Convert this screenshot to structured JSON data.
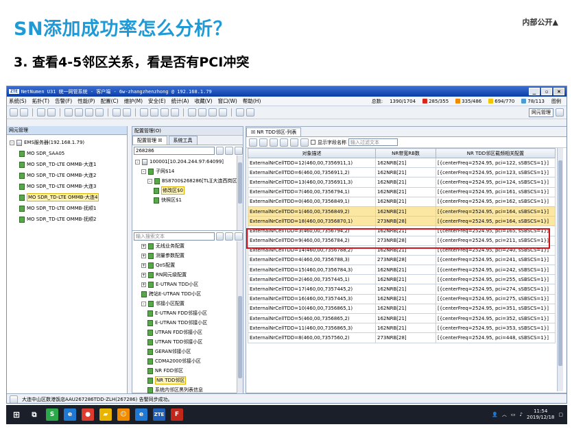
{
  "slide": {
    "title": "SN添加成功率怎么分析？",
    "badge": "内部公开▲",
    "subtitle": "3. 查看4-5邻区关系，看是否有PCI冲突"
  },
  "window": {
    "logo": "ZTE",
    "title": "NetNumen U31 统一网管系统 - 客户端 - 6w-zhangzhenzhong @ 192.168.1.79"
  },
  "menu": [
    "系统(S)",
    "拓扑(T)",
    "告警(F)",
    "性能(P)",
    "配置(C)",
    "维护(M)",
    "安全(E)",
    "统计(A)",
    "收藏(V)",
    "窗口(W)",
    "帮助(H)"
  ],
  "stats": {
    "summary_label": "总数:",
    "summary_value": "1390/1704",
    "items": [
      {
        "value": "285/355",
        "color": "#d9261c"
      },
      {
        "value": "335/486",
        "color": "#f08a00"
      },
      {
        "value": "694/770",
        "color": "#f2c500"
      },
      {
        "value": "78/113",
        "color": "#4a9ad6"
      }
    ],
    "legend_label": "图例"
  },
  "toolbar": {
    "right_combo": "网元管理"
  },
  "left_panel": {
    "title": "网元管理",
    "tree": [
      {
        "label": "EMS服务器(192.168.1.79)",
        "level": 0,
        "expander": "-"
      },
      {
        "label": "MO SDR_SAA05",
        "level": 1
      },
      {
        "label": "MO SDR_TD-LTE OMMB-大连1",
        "level": 1
      },
      {
        "label": "MO SDR_TD-LTE OMMB-大连2",
        "level": 1
      },
      {
        "label": "MO SDR_TD-LTE OMMB-大连3",
        "level": 1
      },
      {
        "label": "MO SDR_TD-LTE OMMB-大连4",
        "level": 1,
        "selected": true
      },
      {
        "label": "MO SDR_TD-LTE OMMB-抚顺1",
        "level": 1
      },
      {
        "label": "MO SDR_TD-LTE OMMB-抚顺2",
        "level": 1
      }
    ]
  },
  "mid_panel": {
    "header": "配置管理(O)",
    "tabs": [
      "配置管理 ☒",
      "系统工具"
    ],
    "search_value": "268286",
    "tree_top": [
      {
        "label": "100001[10.204.244.97:64099]",
        "level": 0,
        "expander": "-"
      },
      {
        "label": "子网$14",
        "level": 1,
        "expander": "-"
      },
      {
        "label": "BS8700$268286[TL][大连西岗区",
        "level": 2,
        "expander": "-"
      },
      {
        "label": "修改区$0",
        "level": 3,
        "selected": true
      },
      {
        "label": "快照区$1",
        "level": 3
      }
    ],
    "search2_placeholder": "输入搜索文本",
    "tree_bottom": [
      {
        "label": "无线业务配置",
        "level": 1,
        "expander": "+"
      },
      {
        "label": "测量参数配置",
        "level": 1,
        "expander": "+"
      },
      {
        "label": "QoS配置",
        "level": 1,
        "expander": "+"
      },
      {
        "label": "RN网元级配置",
        "level": 1,
        "expander": "+"
      },
      {
        "label": "E-UTRAN TDD小区",
        "level": 1,
        "expander": "+"
      },
      {
        "label": "跨站E-UTRAN TDD小区",
        "level": 1
      },
      {
        "label": "邻接小区配置",
        "level": 1,
        "expander": "-"
      },
      {
        "label": "E-UTRAN FDD邻接小区",
        "level": 2
      },
      {
        "label": "E-UTRAN TDD邻接小区",
        "level": 2
      },
      {
        "label": "UTRAN FDD邻接小区",
        "level": 2
      },
      {
        "label": "UTRAN TDD邻接小区",
        "level": 2
      },
      {
        "label": "GERAN邻接小区",
        "level": 2
      },
      {
        "label": "CDMA2000邻接小区",
        "level": 2
      },
      {
        "label": "NR FDD邻区",
        "level": 2
      },
      {
        "label": "NR TDD邻区",
        "level": 2,
        "selected": true
      },
      {
        "label": "系统内邻区黑列表信息",
        "level": 2
      }
    ]
  },
  "right_panel": {
    "tab": "NR TDD邻区-列表",
    "checkbox_label": "显示字段名称",
    "filter_placeholder": "输入过滤文本",
    "columns": [
      "对象描述",
      "NR带宽RB数",
      "NR TDD邻区载频相关配置"
    ],
    "rows": [
      [
        "ExternalNrCellTDD=12(460,00,7356911,1)",
        "162NRB[21]",
        "[{centerFreq=2524.95, pci=122, sSBSCS=1}]"
      ],
      [
        "ExternalNrCellTDD=6(460,00,7356911,2)",
        "162NRB[21]",
        "[{centerFreq=2524.95, pci=123, sSBSCS=1}]"
      ],
      [
        "ExternalNrCellTDD=13(460,00,7356911,3)",
        "162NRB[21]",
        "[{centerFreq=2524.95, pci=124, sSBSCS=1}]"
      ],
      [
        "ExternalNrCellTDD=7(460,00,7356794,1)",
        "162NRB[21]",
        "[{centerFreq=2524.95, pci=161, sSBSCS=1}]"
      ],
      [
        "ExternalNrCellTDD=0(460,00,7356849,1)",
        "162NRB[21]",
        "[{centerFreq=2524.95, pci=162, sSBSCS=1}]"
      ],
      [
        "ExternalNrCellTDD=1(460,00,7356849,2)",
        "162NRB[21]",
        "[{centerFreq=2524.95, pci=164, sSBSCS=1}]"
      ],
      [
        "ExternalNrCellTDD=18(460,00,7356870,1)",
        "273NRB[28]",
        "[{centerFreq=2524.95, pci=164, sSBSCS=1}]"
      ],
      [
        "ExternalNrCellTDD=3(460,00,7356794,2)",
        "162NRB[21]",
        "[{centerFreq=2524.95, pci=165, sSBSCS=1}]"
      ],
      [
        "ExternalNrCellTDD=9(460,00,7356784,2)",
        "273NRB[28]",
        "[{centerFreq=2524.95, pci=211, sSBSCS=1}]"
      ],
      [
        "ExternalNrCellTDD=14(460,00,7356788,2)",
        "162NRB[21]",
        "[{centerFreq=2524.95, pci=240, sSBSCS=1}]"
      ],
      [
        "ExternalNrCellTDD=4(460,00,7356788,3)",
        "273NRB[28]",
        "[{centerFreq=2524.95, pci=241, sSBSCS=1}]"
      ],
      [
        "ExternalNrCellTDD=15(460,00,7356784,3)",
        "162NRB[21]",
        "[{centerFreq=2524.95, pci=242, sSBSCS=1}]"
      ],
      [
        "ExternalNrCellTDD=2(460,00,7357445,1)",
        "162NRB[21]",
        "[{centerFreq=2524.95, pci=255, sSBSCS=1}]"
      ],
      [
        "ExternalNrCellTDD=17(460,00,7357445,2)",
        "162NRB[21]",
        "[{centerFreq=2524.95, pci=274, sSBSCS=1}]"
      ],
      [
        "ExternalNrCellTDD=16(460,00,7357445,3)",
        "162NRB[21]",
        "[{centerFreq=2524.95, pci=275, sSBSCS=1}]"
      ],
      [
        "ExternalNrCellTDD=10(460,00,7356865,1)",
        "162NRB[21]",
        "[{centerFreq=2524.95, pci=351, sSBSCS=1}]"
      ],
      [
        "ExternalNrCellTDD=5(460,00,7356865,2)",
        "162NRB[21]",
        "[{centerFreq=2524.95, pci=352, sSBSCS=1}]"
      ],
      [
        "ExternalNrCellTDD=11(460,00,7356865,3)",
        "162NRB[21]",
        "[{centerFreq=2524.95, pci=353, sSBSCS=1}]"
      ],
      [
        "ExternalNrCellTDD=8(460,00,7357560,2)",
        "273NRB[28]",
        "[{centerFreq=2524.95, pci=448, sSBSCS=1}]"
      ]
    ],
    "highlighted_rows": [
      5,
      6
    ]
  },
  "statusbar": {
    "text": "大连中山区数港饭店AAU267286TDD-ZLH(267286) 告警同步成功。"
  },
  "taskbar": {
    "time": "11:54",
    "date": "2019/12/18",
    "apps": [
      {
        "label": "S",
        "color": "#2aa84a"
      },
      {
        "label": "e",
        "color": "#1f78d1"
      },
      {
        "label": "●",
        "color": "#de3b2f"
      },
      {
        "label": "▰",
        "color": "#e8b400"
      },
      {
        "label": "☺",
        "color": "#f08a00"
      },
      {
        "label": "e",
        "color": "#1f78d1"
      },
      {
        "label": "ZTE",
        "color": "#1f5fb8"
      },
      {
        "label": "F",
        "color": "#c0281c"
      }
    ]
  }
}
